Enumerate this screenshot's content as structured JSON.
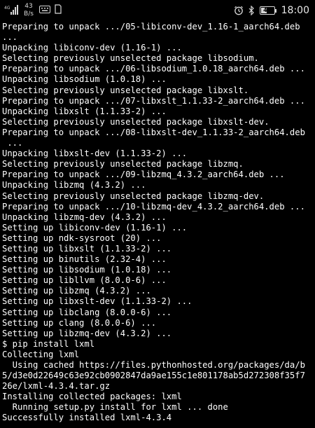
{
  "status_bar": {
    "network_speed_value": "43",
    "network_speed_unit": "B/s",
    "network_type": "4G",
    "battery_level": "44",
    "time": "18:00",
    "icons": [
      "signal-icon",
      "keyboard-icon",
      "sim-icon",
      "alarm-icon",
      "bluetooth-icon",
      "battery-icon"
    ]
  },
  "terminal": {
    "lines": [
      "Preparing to unpack .../05-libiconv-dev_1.16-1_aarch64.deb",
      "...",
      "Unpacking libiconv-dev (1.16-1) ...",
      "Selecting previously unselected package libsodium.",
      "Preparing to unpack .../06-libsodium_1.0.18_aarch64.deb ...",
      "Unpacking libsodium (1.0.18) ...",
      "Selecting previously unselected package libxslt.",
      "Preparing to unpack .../07-libxslt_1.1.33-2_aarch64.deb ...",
      "Unpacking libxslt (1.1.33-2) ...",
      "Selecting previously unselected package libxslt-dev.",
      "Preparing to unpack .../08-libxslt-dev_1.1.33-2_aarch64.deb",
      " ...",
      "Unpacking libxslt-dev (1.1.33-2) ...",
      "Selecting previously unselected package libzmq.",
      "Preparing to unpack .../09-libzmq_4.3.2_aarch64.deb ...",
      "Unpacking libzmq (4.3.2) ...",
      "Selecting previously unselected package libzmq-dev.",
      "Preparing to unpack .../10-libzmq-dev_4.3.2_aarch64.deb ...",
      "Unpacking libzmq-dev (4.3.2) ...",
      "Setting up libiconv-dev (1.16-1) ...",
      "Setting up ndk-sysroot (20) ...",
      "Setting up libxslt (1.1.33-2) ...",
      "Setting up binutils (2.32-4) ...",
      "Setting up libsodium (1.0.18) ...",
      "Setting up libllvm (8.0.0-6) ...",
      "Setting up libzmq (4.3.2) ...",
      "Setting up libxslt-dev (1.1.33-2) ...",
      "Setting up libclang (8.0.0-6) ...",
      "Setting up clang (8.0.0-6) ...",
      "Setting up libzmq-dev (4.3.2) ...",
      "$ pip install lxml",
      "Collecting lxml",
      "  Using cached https://files.pythonhosted.org/packages/da/b",
      "5/d3e0d22649c63e92cb0902847da9ae155c1e801178ab5d272308f35f7",
      "26e/lxml-4.3.4.tar.gz",
      "Installing collected packages: lxml",
      "  Running setup.py install for lxml ... done",
      "Successfully installed lxml-4.3.4"
    ]
  },
  "colors": {
    "background": "#000000",
    "text": "#ffffff",
    "status_icons": "#d8d8d8"
  }
}
